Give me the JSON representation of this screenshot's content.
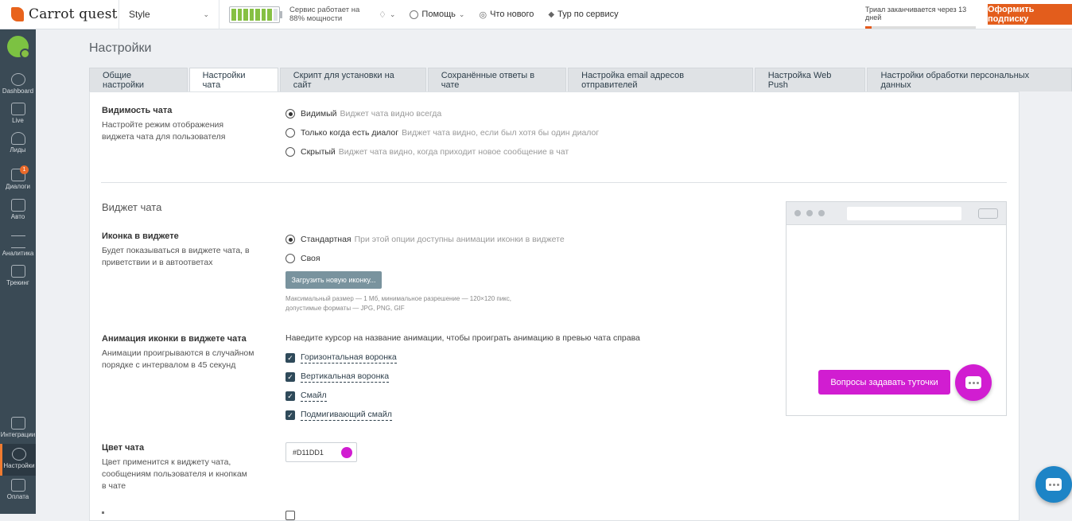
{
  "topbar": {
    "logo": "Carrot quest",
    "app_select": "Style",
    "battery_text_1": "Сервис работает на",
    "battery_text_2": "88% мощности",
    "battery_level": 0.88,
    "help": "Помощь",
    "whats_new": "Что нового",
    "tour": "Тур по сервису",
    "trial_text": "Триал заканчивается через 13 дней",
    "subscribe": "Оформить подписку"
  },
  "sidebar": {
    "items": [
      {
        "label": "Dashboard"
      },
      {
        "label": "Live"
      },
      {
        "label": "Лиды"
      },
      {
        "label": "Диалоги",
        "badge": "1"
      },
      {
        "label": "Авто"
      },
      {
        "label": "Аналитика"
      },
      {
        "label": "Трекинг"
      },
      {
        "label": "Интеграции"
      },
      {
        "label": "Настройки"
      },
      {
        "label": "Оплата"
      }
    ]
  },
  "page": {
    "title": "Настройки",
    "tabs": [
      "Общие настройки",
      "Настройки чата",
      "Скрипт для установки на сайт",
      "Сохранённые ответы в чате",
      "Настройка email адресов отправителей",
      "Настройка Web Push",
      "Настройки обработки персональных данных"
    ]
  },
  "visibility": {
    "title": "Видимость чата",
    "desc": "Настройте режим отображения виджета чата для пользователя",
    "options": [
      {
        "main": "Видимый",
        "sub": "Виджет чата видно всегда",
        "selected": true
      },
      {
        "main": "Только когда есть диалог",
        "sub": "Виджет чата видно, если был хотя бы один диалог",
        "selected": false
      },
      {
        "main": "Скрытый",
        "sub": "Виджет чата видно, когда приходит новое сообщение в чат",
        "selected": false
      }
    ]
  },
  "widget": {
    "section": "Виджет чата",
    "icon_title": "Иконка в виджете",
    "icon_desc": "Будет показываться в виджете чата, в приветствии и в автоответах",
    "icon_options": [
      {
        "main": "Стандартная",
        "sub": "При этой опции доступны анимации иконки в виджете",
        "selected": true
      },
      {
        "main": "Своя",
        "sub": "",
        "selected": false
      }
    ],
    "upload": "Загрузить новую иконку...",
    "hint": "Максимальный размер — 1 Мб, минимальное разрешение — 120×120 пикс, допустимые форматы — JPG, PNG, GIF",
    "anim_title": "Анимация иконки в виджете чата",
    "anim_desc": "Анимации проигрываются в случайном порядке с интервалом в 45 секунд",
    "anim_hint": "Наведите курсор на название анимации, чтобы проиграть анимацию в превью чата справа",
    "animations": [
      "Горизонтальная воронка",
      "Вертикальная воронка",
      "Смайл",
      "Подмигивающий смайл"
    ],
    "color_title": "Цвет чата",
    "color_desc": "Цвет применится к виджету чата, сообщениям пользователя и кнопкам в чате",
    "color_value": "#D11DD1"
  },
  "preview": {
    "bubble": "Вопросы задавать туточки"
  },
  "colors": {
    "accent": "#D11DD1",
    "subscribe": "#e35d1c",
    "sidebar": "#3a4a55",
    "float_chat": "#1d84c6"
  }
}
